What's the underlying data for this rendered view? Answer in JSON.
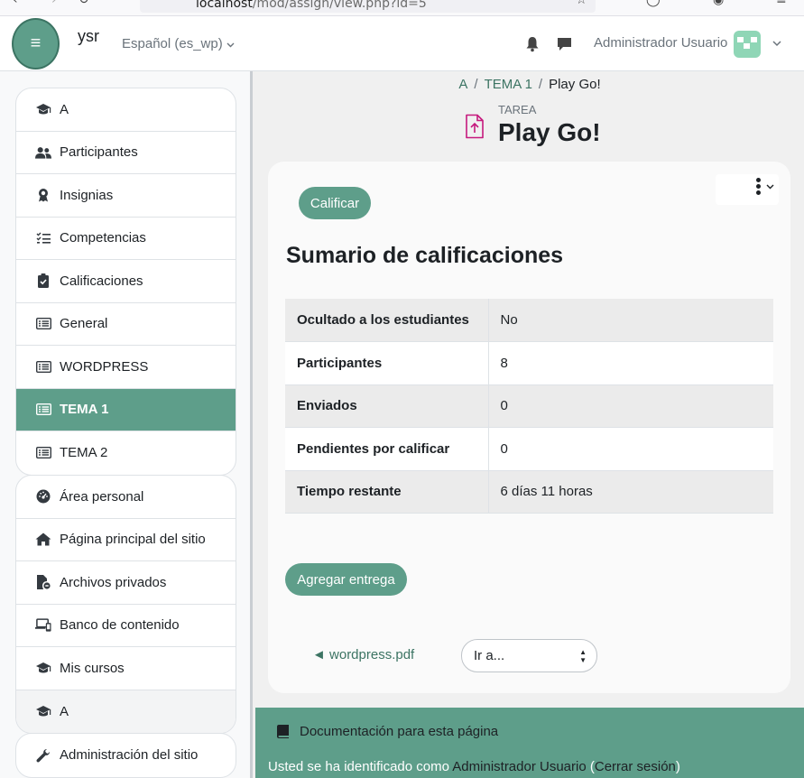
{
  "browser": {
    "url_host": "localhost",
    "url_path": "/mod/assign/view.php?id=5"
  },
  "navbar": {
    "site_name": "ysr",
    "language": "Español (es_wp)",
    "user_name": "Administrador Usuario"
  },
  "sidebar": {
    "course_items": [
      {
        "label": "A",
        "icon": "graduation-cap-icon"
      },
      {
        "label": "Participantes",
        "icon": "users-icon"
      },
      {
        "label": "Insignias",
        "icon": "badge-icon"
      },
      {
        "label": "Competencias",
        "icon": "checklist-icon"
      },
      {
        "label": "Calificaciones",
        "icon": "clipboard-check-icon"
      },
      {
        "label": "General",
        "icon": "section-list-icon"
      },
      {
        "label": "WORDPRESS",
        "icon": "section-list-icon"
      },
      {
        "label": "TEMA 1",
        "icon": "section-list-icon",
        "active": true
      },
      {
        "label": "TEMA 2",
        "icon": "section-list-icon"
      }
    ],
    "site_items": [
      {
        "label": "Área personal",
        "icon": "dashboard-gauge-icon"
      },
      {
        "label": "Página principal del sitio",
        "icon": "home-icon"
      },
      {
        "label": "Archivos privados",
        "icon": "private-files-icon"
      },
      {
        "label": "Banco de contenido",
        "icon": "content-bank-icon"
      },
      {
        "label": "Mis cursos",
        "icon": "graduation-cap-icon"
      },
      {
        "label": "A",
        "icon": "graduation-cap-icon"
      }
    ],
    "admin_item": {
      "label": "Administración del sitio",
      "icon": "wrench-icon"
    }
  },
  "breadcrumb": [
    "A",
    "TEMA 1",
    "Play Go!"
  ],
  "header": {
    "module_type": "TAREA",
    "title": "Play Go!"
  },
  "card": {
    "grade_button": "Calificar",
    "summary_heading": "Sumario de calificaciones",
    "rows": [
      {
        "key": "Ocultado a los estudiantes",
        "value": "No"
      },
      {
        "key": "Participantes",
        "value": "8"
      },
      {
        "key": "Enviados",
        "value": "0"
      },
      {
        "key": "Pendientes por calificar",
        "value": "0"
      },
      {
        "key": "Tiempo restante",
        "value": "6 días 11 horas"
      }
    ],
    "add_submission_button": "Agregar entrega",
    "prev_activity_link": "◄ wordpress.pdf",
    "jump_to_select": "Ir a..."
  },
  "footer": {
    "doc_link": "Documentación para esta página",
    "login_prefix": "Usted se ha identificado como ",
    "login_user": "Administrador Usuario",
    "open_paren": " (",
    "logout": "Cerrar sesión",
    "close_paren": ")"
  },
  "colors": {
    "brand": "#5e9e8a",
    "brand_dark": "#3c7463",
    "assignment_icon": "#c5197d",
    "avatar": "#8fd6b6"
  }
}
